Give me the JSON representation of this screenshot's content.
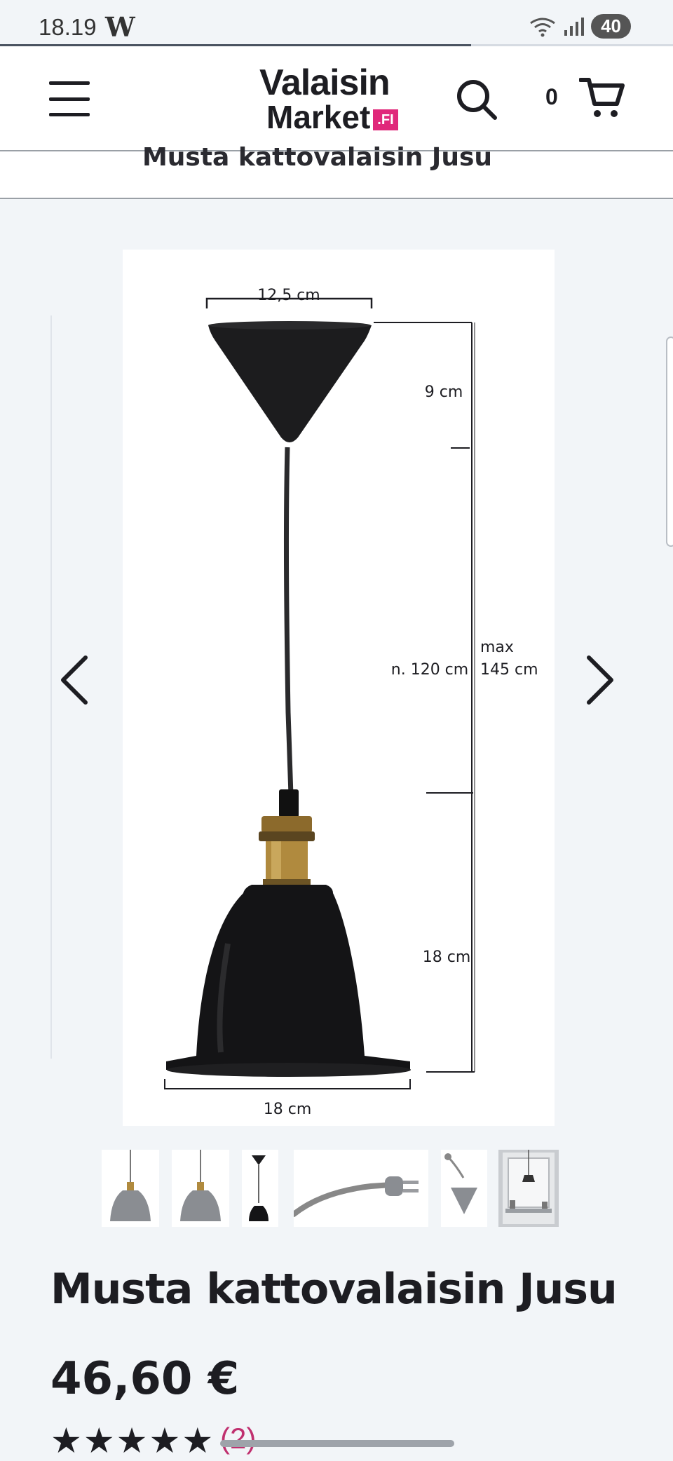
{
  "status_bar": {
    "time": "18.19",
    "app_glyph": "W",
    "battery": "40"
  },
  "page_progress": 0.7,
  "header": {
    "logo_line1": "Valaisin",
    "logo_line2": "Market",
    "logo_badge": ".FI",
    "cart_count": "0",
    "brand_color": "#e0287a"
  },
  "subtitle": "Musta kattovalaisin Jusu",
  "gallery": {
    "dimensions": {
      "canopy_width": "12,5 cm",
      "canopy_height": "9 cm",
      "cord_length": "n. 120 cm",
      "max_label": "max",
      "max_length": "145 cm",
      "shade_height": "18 cm",
      "shade_width": "18 cm"
    },
    "thumbnail_count": 6
  },
  "product": {
    "title": "Musta kattovalaisin Jusu",
    "price": "46,60 €",
    "rating": 5,
    "review_count": "(2)"
  }
}
